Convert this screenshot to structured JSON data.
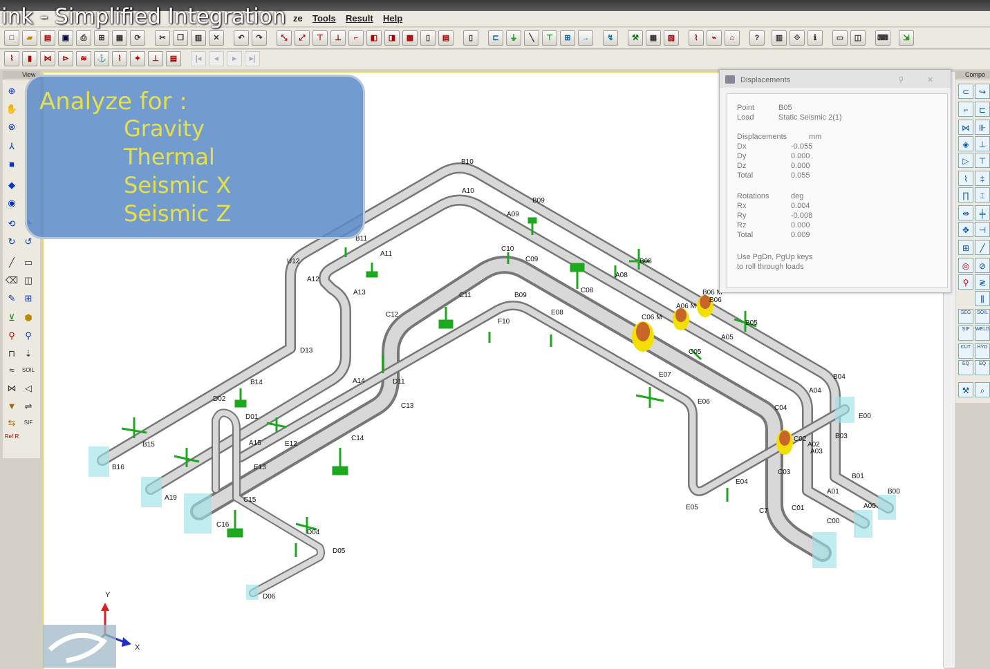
{
  "video_title": "ink - Simplified Integration",
  "menu": {
    "partial": "ze",
    "tools": "Tools",
    "result": "Result",
    "help": "Help"
  },
  "left_panel": {
    "header": "View",
    "soil_label": "SOIL",
    "sif_label": "SIF",
    "ref_label": "Ref R"
  },
  "right_panel": {
    "header": "Compo",
    "btn_seg": "SEG",
    "btn_soil": "SOIL",
    "btn_sif": "SIF",
    "btn_weld": "WELD",
    "btn_cut": "CUT",
    "btn_hyd": "HYD",
    "btn_eq": "EQ",
    "btn_eq2": "EQ"
  },
  "callout": {
    "title": "Analyze for :",
    "items": [
      "Gravity",
      "Thermal",
      "Seismic X",
      "Seismic Z"
    ]
  },
  "displacements": {
    "title": "Displacements",
    "point_label": "Point",
    "point_value": "B05",
    "load_label": "Load",
    "load_value": "Static Seismic 2(1)",
    "disp_header": "Displacements",
    "disp_unit": "mm",
    "disp_rows": [
      {
        "label": "Dx",
        "value": "-0.055"
      },
      {
        "label": "Dy",
        "value": "0.000"
      },
      {
        "label": "Dz",
        "value": "0.000"
      },
      {
        "label": "Total",
        "value": "0.055"
      }
    ],
    "rot_header": "Rotations",
    "rot_unit": "deg",
    "rot_rows": [
      {
        "label": "Rx",
        "value": "0.004"
      },
      {
        "label": "Ry",
        "value": "-0.008"
      },
      {
        "label": "Rz",
        "value": "0.000"
      },
      {
        "label": "Total",
        "value": "0.009"
      }
    ],
    "hint_line1": "Use PgDn, PgUp keys",
    "hint_line2": "to roll through loads"
  },
  "axes": {
    "y": "Y",
    "x": "X"
  },
  "node_labels": {
    "b10": "B10",
    "a10": "A10",
    "b09": "B09",
    "a09": "A09",
    "b11": "B11",
    "a11": "A11",
    "u12": "U12",
    "a12": "A12",
    "a13": "A13",
    "c10": "C10",
    "c09": "C09",
    "c11": "C11",
    "b09b": "B09",
    "c12": "C12",
    "f10": "F10",
    "e08": "E08",
    "c08": "C08",
    "a08": "A08",
    "b08": "B08",
    "d13": "D13",
    "b14": "B14",
    "a14": "A14",
    "d11": "D11",
    "c13": "C13",
    "d02": "D02",
    "d01": "D01",
    "b15": "B15",
    "b16": "B16",
    "a15": "A15",
    "e12": "E12",
    "c14": "C14",
    "e13": "E13",
    "a19": "A19",
    "c15": "C15",
    "c16": "C16",
    "d04": "D04",
    "d05": "D05",
    "d06": "D06",
    "b06m": "B06 M",
    "b06": "B06",
    "a06m": "A06 M",
    "c06m": "C06 M",
    "b05": "B05",
    "a05": "A05",
    "c05": "C05",
    "e06": "E06",
    "e07": "E07",
    "b04": "B04",
    "a04": "A04",
    "e00": "E00",
    "c04": "C04",
    "b03": "B03",
    "a02": "A02",
    "a03": "A03",
    "c03": "C03",
    "e04": "E04",
    "e05": "E05",
    "b01": "B01",
    "a01": "A01",
    "b00": "B00",
    "c01": "C01",
    "a00": "A00",
    "c00": "C00",
    "c7": "C7",
    "c02": "C02"
  }
}
